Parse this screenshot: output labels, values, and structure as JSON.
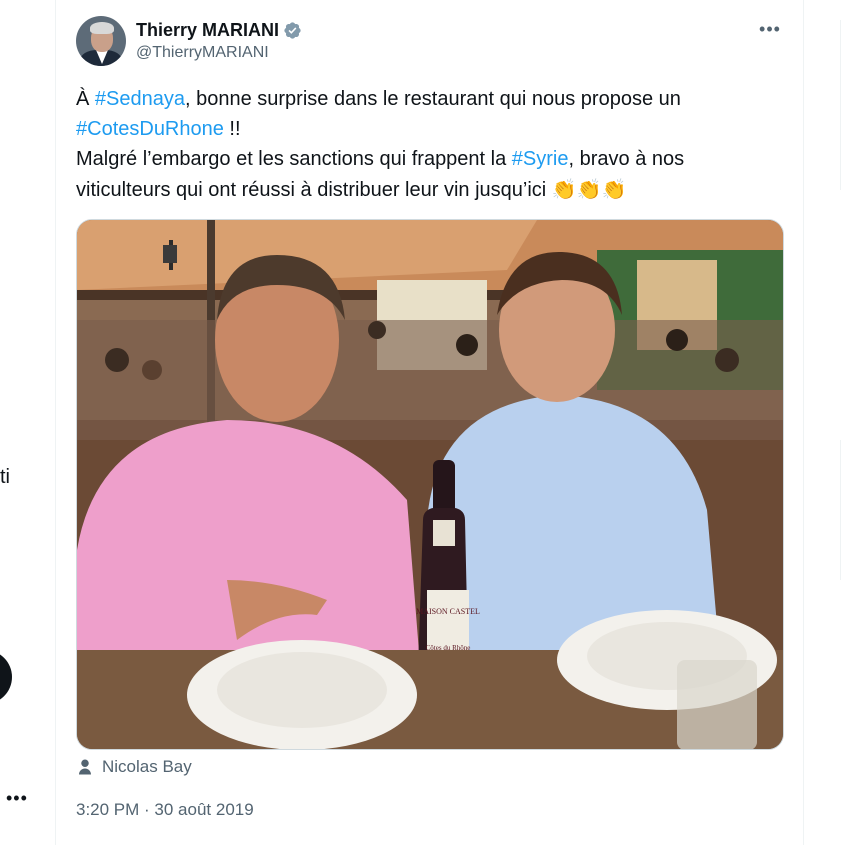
{
  "left_column": {
    "fragment_text": "ti",
    "more_label": "•••"
  },
  "tweet": {
    "author": {
      "display_name": "Thierry MARIANI",
      "handle": "@ThierryMARIANI",
      "verified": true
    },
    "more_label": "•••",
    "text": {
      "line1_prefix": "À ",
      "hashtag1": "#Sednaya",
      "line1_suffix": ", bonne surprise dans le restaurant qui nous propose un",
      "hashtag2": "#CotesDuRhone",
      "line2_suffix": " !!",
      "line3_prefix": "Malgré l’embargo et les sanctions  qui frappent la ",
      "hashtag3": "#Syrie",
      "line3_suffix": ", bravo à nos",
      "line4": "viticulteurs qui ont réussi à distribuer leur vin jusqu’ici ",
      "emoji": "👏👏👏"
    },
    "media": {
      "bottle_label_brand": "MAISON CASTEL",
      "bottle_label_wine": "Côtes du Rhône"
    },
    "tagged_user": "Nicolas Bay",
    "timestamp": "3:20 PM · 30 août 2019"
  },
  "colors": {
    "link": "#1d9bf0",
    "secondary_text": "#536471",
    "primary_text": "#0f1419",
    "verified": "#829aab"
  },
  "icons": {
    "verified": "verified-badge-icon",
    "more": "more-horizontal-icon",
    "tagged": "person-icon"
  }
}
